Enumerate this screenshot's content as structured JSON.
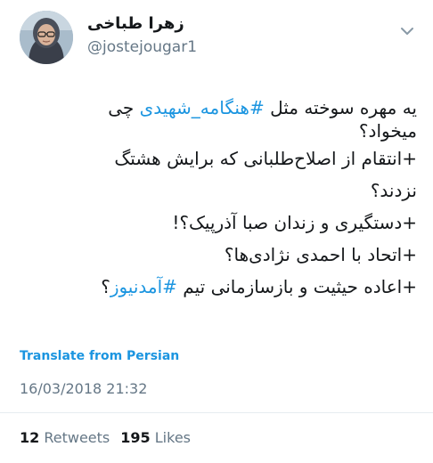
{
  "user": {
    "name": "زهرا طباخی",
    "handle": "@jostejougar1"
  },
  "tweet": {
    "line1_pre": "یه مهره سوخته مثل ",
    "line1_hashtag": "#هنگامه_شهیدی",
    "line1_post": " چی",
    "line2": "میخواد؟",
    "line3": "+انتقام از اصلاح‌طلبانی که برایش هشتگ",
    "line4": "نزدند؟",
    "line5": "+دستگیری و زندان صبا آذرپیک؟!",
    "line6": "+اتحاد با احمدی نژادی‌ها؟",
    "line7_pre": "+اعاده حیثیت و بازسازمانی تیم ",
    "line7_hashtag": "#آمدنیوز",
    "line7_post": "؟"
  },
  "translate_label": "Translate from Persian",
  "timestamp": "16/03/2018 21:32",
  "stats": {
    "retweets_count": "12",
    "retweets_label": "Retweets",
    "likes_count": "195",
    "likes_label": "Likes"
  },
  "icons": {
    "menu": "chevron-down-icon"
  },
  "colors": {
    "link": "#1b95e0",
    "secondary_text": "#657786"
  }
}
